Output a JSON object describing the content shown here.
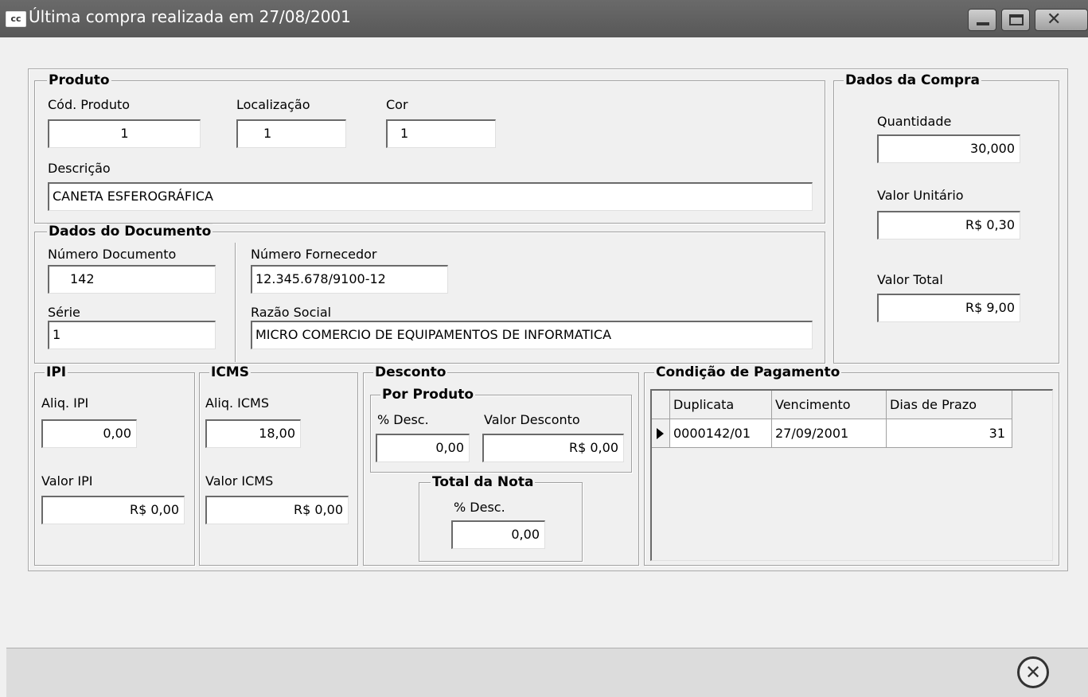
{
  "window": {
    "icon": "cc",
    "title": "Última compra realizada em 27/08/2001",
    "buttons": [
      "minimize",
      "maximize",
      "close"
    ]
  },
  "produto": {
    "legend": "Produto",
    "cod_label": "Cód. Produto",
    "cod_value": "1",
    "loc_label": "Localização",
    "loc_value": "1",
    "cor_label": "Cor",
    "cor_value": "1",
    "desc_label": "Descrição",
    "desc_value": "CANETA ESFEROGRÁFICA"
  },
  "documento": {
    "legend": "Dados do Documento",
    "numdoc_label": "Número Documento",
    "numdoc_value": "142",
    "serie_label": "Série",
    "serie_value": "1",
    "numforn_label": "Número Fornecedor",
    "numforn_value": "12.345.678/9100-12",
    "razao_label": "Razão Social",
    "razao_value": "MICRO COMERCIO DE EQUIPAMENTOS DE INFORMATICA"
  },
  "compra": {
    "legend": "Dados da Compra",
    "qtd_label": "Quantidade",
    "qtd_value": "30,000",
    "vunit_label": "Valor Unitário",
    "vunit_value": "R$ 0,30",
    "vtotal_label": "Valor Total",
    "vtotal_value": "R$ 9,00"
  },
  "ipi": {
    "legend": "IPI",
    "aliq_label": "Aliq. IPI",
    "aliq_value": "0,00",
    "valor_label": "Valor IPI",
    "valor_value": "R$ 0,00"
  },
  "icms": {
    "legend": "ICMS",
    "aliq_label": "Aliq. ICMS",
    "aliq_value": "18,00",
    "valor_label": "Valor ICMS",
    "valor_value": "R$ 0,00"
  },
  "desconto": {
    "legend": "Desconto",
    "produto_legend": "Por Produto",
    "pdesc_label": "% Desc.",
    "pdesc_value": "0,00",
    "vdesc_label": "Valor Desconto",
    "vdesc_value": "R$ 0,00",
    "nota_legend": "Total da Nota",
    "ndesc_label": "% Desc.",
    "ndesc_value": "0,00"
  },
  "pagamento": {
    "legend": "Condição de Pagamento",
    "columns": [
      "Duplicata",
      "Vencimento",
      "Dias de Prazo"
    ],
    "rows": [
      [
        "0000142/01",
        "27/09/2001",
        "31"
      ]
    ]
  },
  "footer": {
    "close_icon": "close-circle-icon"
  }
}
